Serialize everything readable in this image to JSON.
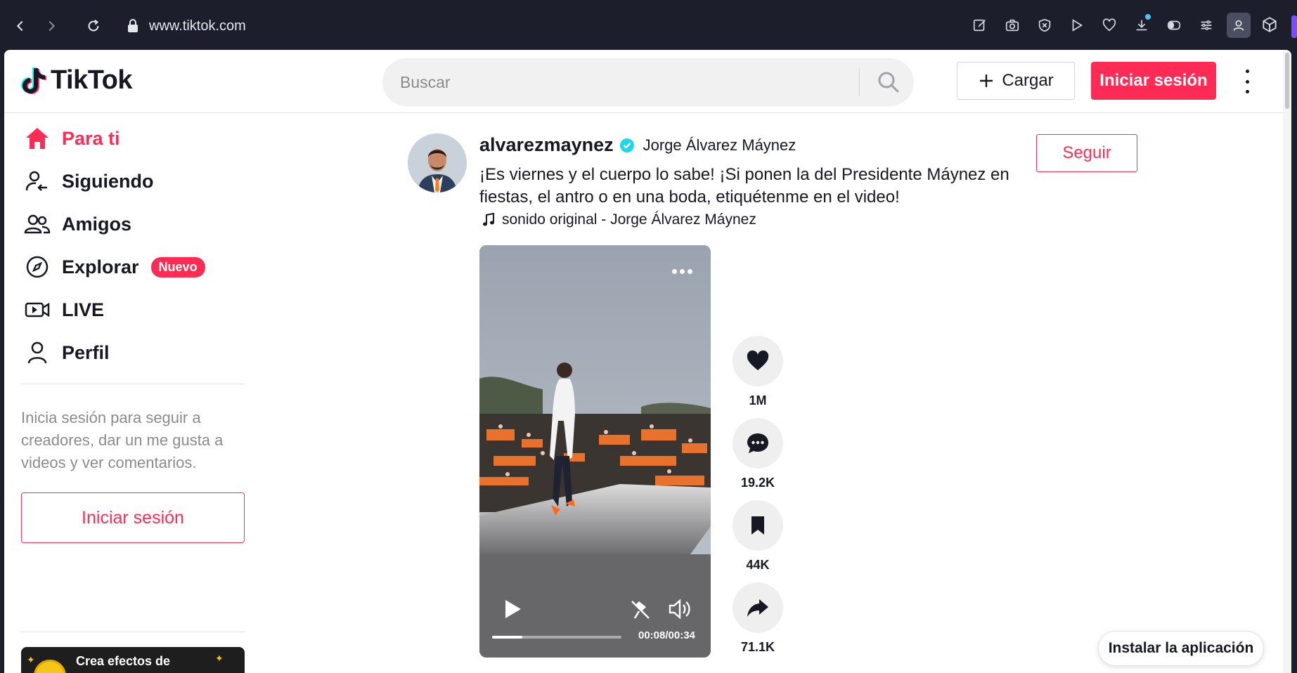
{
  "browser": {
    "url": "www.tiktok.com",
    "extensions": [
      "edit-icon",
      "camera-icon",
      "shield-icon",
      "play-icon",
      "heart-icon",
      "download-icon",
      "battery-icon",
      "settings-sliders-icon",
      "profile-icon"
    ]
  },
  "header": {
    "logo_text": "TikTok",
    "search_placeholder": "Buscar",
    "upload_label": "Cargar",
    "login_label": "Iniciar sesión"
  },
  "sidebar": {
    "items": [
      {
        "label": "Para ti",
        "icon": "home-icon",
        "active": true
      },
      {
        "label": "Siguiendo",
        "icon": "following-icon"
      },
      {
        "label": "Amigos",
        "icon": "friends-icon"
      },
      {
        "label": "Explorar",
        "icon": "compass-icon",
        "badge": "Nuevo"
      },
      {
        "label": "LIVE",
        "icon": "live-icon"
      },
      {
        "label": "Perfil",
        "icon": "profile-icon"
      }
    ],
    "login_prompt": "Inicia sesión para seguir a creadores, dar un me gusta a videos y ver comentarios.",
    "login_button": "Iniciar sesión",
    "effects_card_title": "Crea efectos de"
  },
  "post": {
    "username": "alvarezmaynez",
    "display_name": "Jorge Álvarez Máynez",
    "caption": "¡Es viernes y el cuerpo lo sabe! ¡Si ponen la del Presidente Máynez en fiestas, el antro o en una boda, etiquétenme en el video!",
    "sound": "sonido original - Jorge Álvarez Máynez",
    "follow_label": "Seguir",
    "video": {
      "time": "00:08/00:34",
      "progress": 0.235
    },
    "actions": {
      "likes": "1M",
      "comments": "19.2K",
      "saves": "44K",
      "shares": "71.1K"
    }
  },
  "install_label": "Instalar la aplicación",
  "colors": {
    "brand": "#fe2c55",
    "verified": "#20d5ec"
  }
}
